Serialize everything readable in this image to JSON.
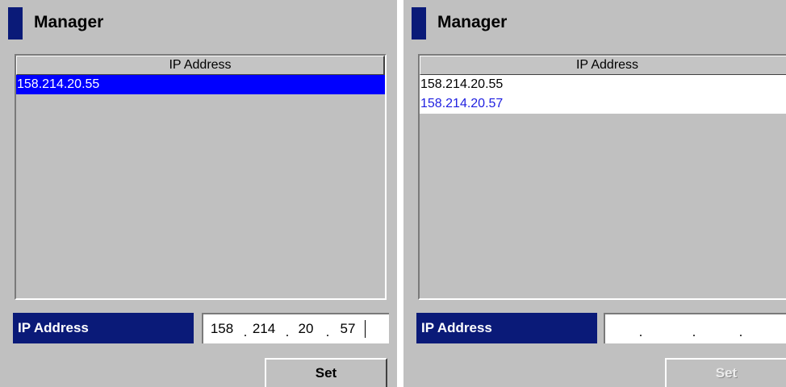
{
  "panels": [
    {
      "title": "Manager",
      "list_header": "IP Address",
      "rows": [
        "158.214.20.55"
      ],
      "ip_label": "IP Address",
      "ip_octets": [
        "158",
        "214",
        "20",
        "57"
      ],
      "dot": ".",
      "set_label": "Set",
      "set_enabled": true
    },
    {
      "title": "Manager",
      "list_header": "IP Address",
      "rows": [
        "158.214.20.55",
        "158.214.20.57"
      ],
      "ip_label": "IP Address",
      "ip_octets": [
        "",
        "",
        "",
        ""
      ],
      "dot": ".",
      "set_label": "Set",
      "set_enabled": false
    }
  ],
  "colors": {
    "panel_bg": "#c0c0c0",
    "title_accent": "#0a1a78",
    "selection": "#0000ff",
    "new_entry_text": "#1f1fe0"
  }
}
